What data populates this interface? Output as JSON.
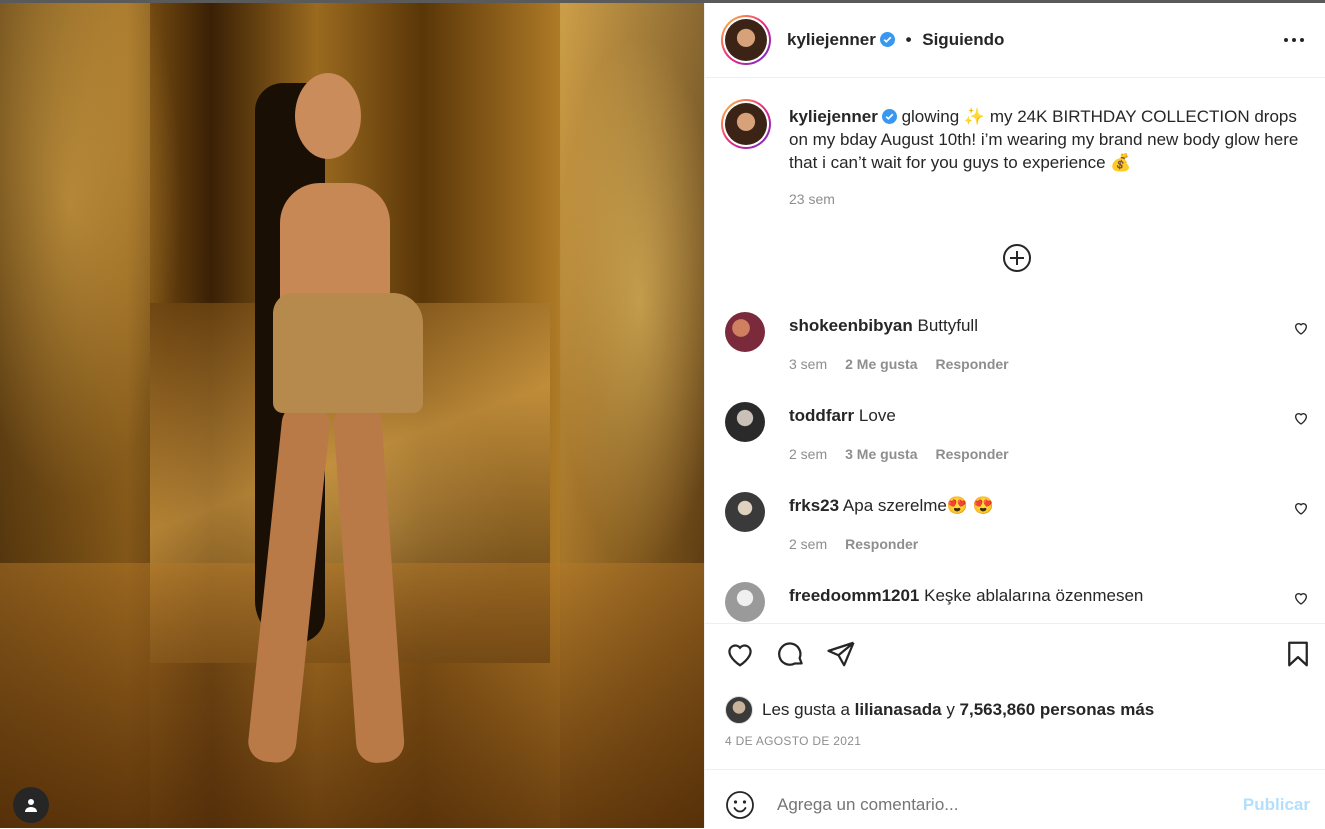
{
  "post": {
    "username": "kyliejenner",
    "follow_status": "Siguiendo",
    "caption": "glowing ✨ my 24K BIRTHDAY COLLECTION drops on my bday August 10th! i’m wearing my brand new body glow here that i can’t wait for you guys to experience 💰",
    "caption_time": "23 sem"
  },
  "comments": [
    {
      "user": "shokeenbibyan",
      "text": "Buttyfull",
      "time": "3 sem",
      "likes": "2 Me gusta",
      "reply": "Responder",
      "avatar_color": "#7a2a3a"
    },
    {
      "user": "toddfarr",
      "text": "Love",
      "time": "2 sem",
      "likes": "3 Me gusta",
      "reply": "Responder",
      "avatar_color": "#2a2a2a"
    },
    {
      "user": "frks23",
      "text": "Apa szerelme😍 😍",
      "time": "2 sem",
      "likes": "",
      "reply": "Responder",
      "avatar_color": "#3a3a3a"
    },
    {
      "user": "freedoomm1201",
      "text": "Keşke ablalarına özenmesen",
      "time": "",
      "likes": "",
      "reply": "",
      "avatar_color": "#9a9a9a"
    }
  ],
  "likes_bar": {
    "prefix": "Les gusta a",
    "liker": "lilianasada",
    "conj": "y",
    "others": "7,563,860 personas más"
  },
  "date": "4 DE AGOSTO DE 2021",
  "comment_box": {
    "placeholder": "Agrega un comentario...",
    "publish": "Publicar"
  },
  "colors": {
    "verified": "#3897f0",
    "publish_disabled": "#b2dffc",
    "muted": "#8e8e8e"
  }
}
